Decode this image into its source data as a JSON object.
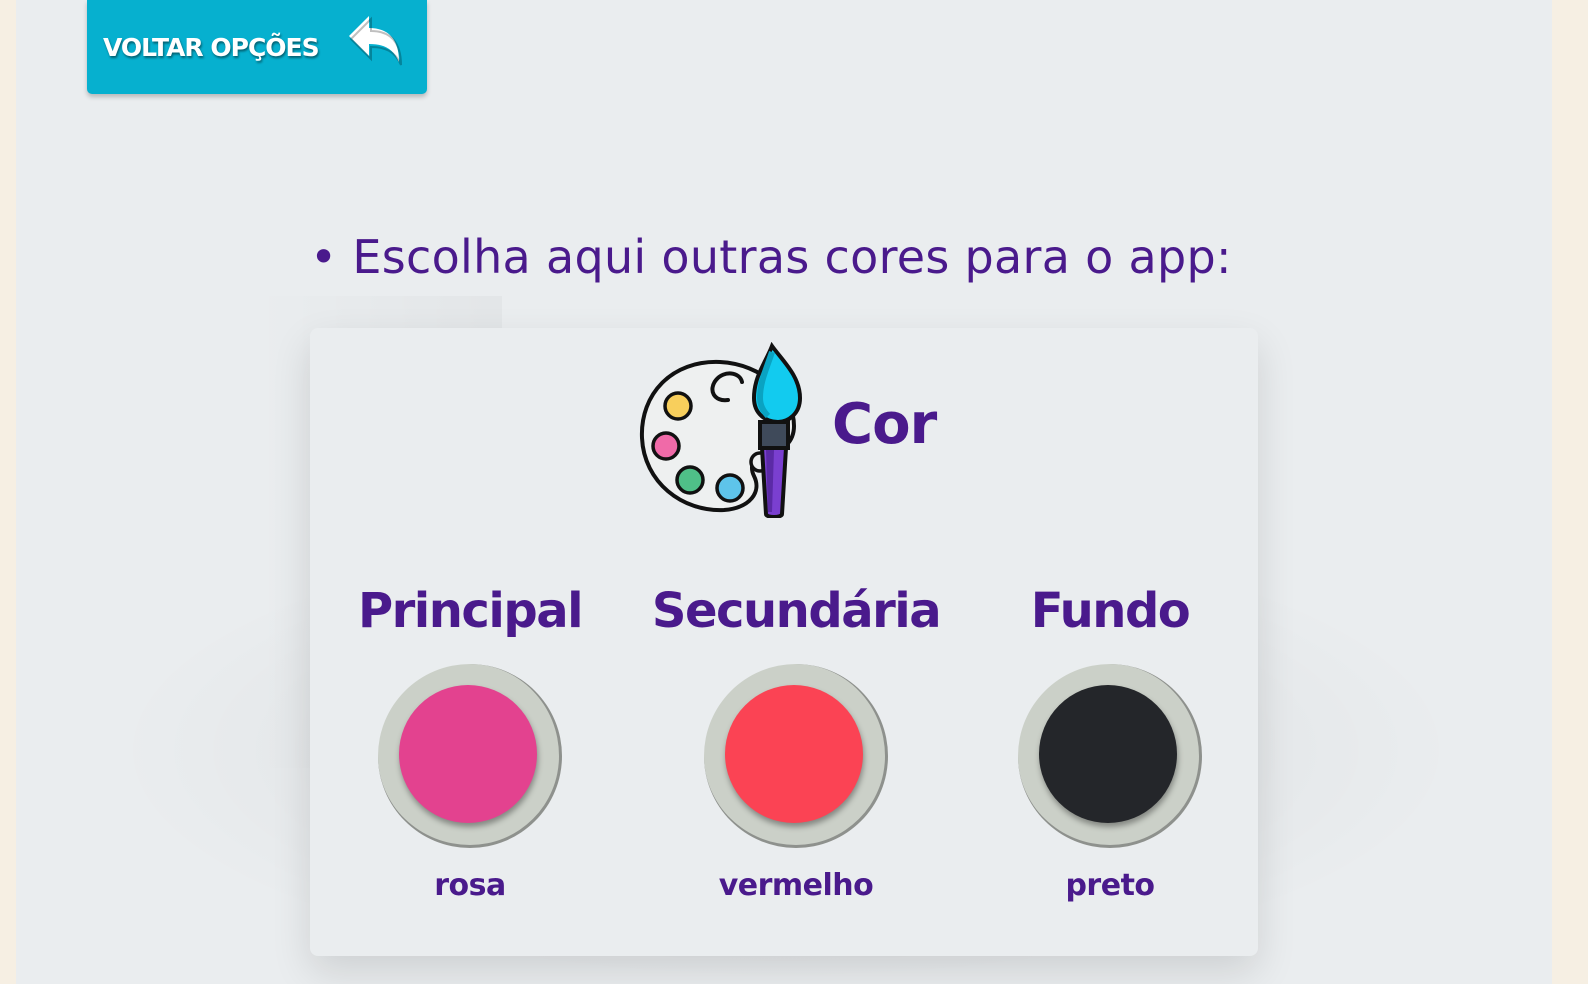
{
  "header": {
    "back_label": "VOLTAR OPÇÕES",
    "back_icon": "undo-arrow-icon"
  },
  "instruction": "• Escolha aqui outras cores para o app:",
  "card": {
    "icon": "palette-brush-icon",
    "title": "Cor",
    "colors": [
      {
        "label": "Principal",
        "value": "rosa",
        "hex": "#e3428f"
      },
      {
        "label": "Secundária",
        "value": "vermelho",
        "hex": "#fb4354"
      },
      {
        "label": "Fundo",
        "value": "preto",
        "hex": "#24262a"
      }
    ]
  },
  "theme": {
    "accent": "#06b0cf",
    "text": "#4a1a8c",
    "background": "#eaedef"
  }
}
